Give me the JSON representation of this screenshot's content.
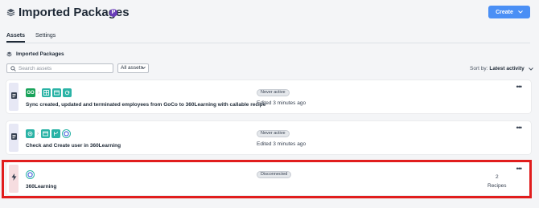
{
  "header": {
    "title": "Imported Packages",
    "badge": "P",
    "create_label": "Create"
  },
  "tabs": [
    {
      "label": "Assets",
      "active": true
    },
    {
      "label": "Settings",
      "active": false
    }
  ],
  "section": {
    "title": "Imported Packages"
  },
  "search": {
    "placeholder": "Search assets",
    "value": ""
  },
  "filter": {
    "selected": "All assets"
  },
  "sort": {
    "label": "Sort by:",
    "value": "Latest activity"
  },
  "cards": [
    {
      "type": "recipe",
      "name": "Sync created, updated and terminated employees from GoCo to 360Learning with callable recipe",
      "status": "Never active",
      "edited": "Edited 3 minutes ago",
      "icons": [
        "goco-icon",
        "table-icon",
        "window-icon",
        "refresh-icon"
      ],
      "side_color": "#e7e8f5"
    },
    {
      "type": "recipe",
      "name": "Check and Create user in 360Learning",
      "status": "Never active",
      "edited": "Edited 3 minutes ago",
      "icons": [
        "target-icon",
        "window-icon",
        "branch-icon",
        "360learning-icon"
      ],
      "side_color": "#e7e8f5"
    },
    {
      "type": "connection",
      "name": "360Learning",
      "status": "Disconnected",
      "recipes_count": "2",
      "recipes_label": "Recipes",
      "icons": [
        "360learning-icon"
      ],
      "side_color": "#f6dde0"
    }
  ],
  "colors": {
    "accent": "#4a8ff5",
    "badge": "#6a3db8",
    "app_teal": "#2bb3a6",
    "goco_green": "#1aa35a",
    "highlight": "#e11d1d"
  }
}
